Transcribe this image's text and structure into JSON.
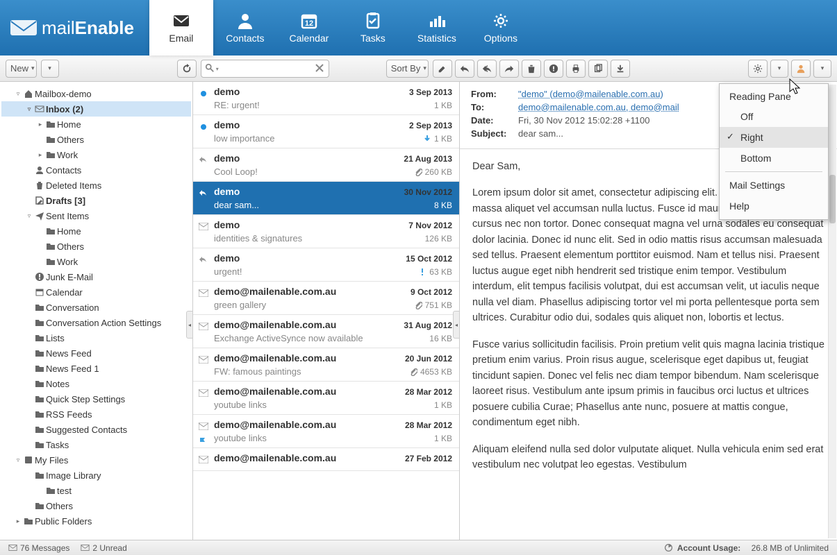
{
  "app": {
    "brand1": "mail",
    "brand2": "Enable"
  },
  "nav": [
    {
      "label": "Email",
      "active": true
    },
    {
      "label": "Contacts"
    },
    {
      "label": "Calendar",
      "badge": "12"
    },
    {
      "label": "Tasks"
    },
    {
      "label": "Statistics"
    },
    {
      "label": "Options"
    }
  ],
  "toolbar": {
    "new": "New",
    "sortby": "Sort By"
  },
  "tree": [
    {
      "indent": 1,
      "exp": "▿",
      "ico": "home",
      "label": "Mailbox-demo"
    },
    {
      "indent": 2,
      "exp": "▿",
      "ico": "mail",
      "label": "Inbox (2)",
      "selected": true,
      "bold": true
    },
    {
      "indent": 3,
      "exp": "▸",
      "ico": "folder",
      "label": "Home"
    },
    {
      "indent": 3,
      "exp": "",
      "ico": "folder",
      "label": "Others"
    },
    {
      "indent": 3,
      "exp": "▸",
      "ico": "folder",
      "label": "Work"
    },
    {
      "indent": 2,
      "exp": "",
      "ico": "contacts",
      "label": "Contacts"
    },
    {
      "indent": 2,
      "exp": "",
      "ico": "trash",
      "label": "Deleted Items"
    },
    {
      "indent": 2,
      "exp": "",
      "ico": "draft",
      "label": "Drafts [3]",
      "bold": true
    },
    {
      "indent": 2,
      "exp": "▿",
      "ico": "sent",
      "label": "Sent Items"
    },
    {
      "indent": 3,
      "exp": "",
      "ico": "folder",
      "label": "Home"
    },
    {
      "indent": 3,
      "exp": "",
      "ico": "folder",
      "label": "Others"
    },
    {
      "indent": 3,
      "exp": "",
      "ico": "folder",
      "label": "Work"
    },
    {
      "indent": 2,
      "exp": "",
      "ico": "junk",
      "label": "Junk E-Mail"
    },
    {
      "indent": 2,
      "exp": "",
      "ico": "cal",
      "label": "Calendar"
    },
    {
      "indent": 2,
      "exp": "",
      "ico": "folder",
      "label": "Conversation"
    },
    {
      "indent": 2,
      "exp": "",
      "ico": "folder",
      "label": "Conversation Action Settings"
    },
    {
      "indent": 2,
      "exp": "",
      "ico": "folder",
      "label": "Lists"
    },
    {
      "indent": 2,
      "exp": "",
      "ico": "folder",
      "label": "News Feed"
    },
    {
      "indent": 2,
      "exp": "",
      "ico": "folder",
      "label": "News Feed 1"
    },
    {
      "indent": 2,
      "exp": "",
      "ico": "folder",
      "label": "Notes"
    },
    {
      "indent": 2,
      "exp": "",
      "ico": "folder",
      "label": "Quick Step Settings"
    },
    {
      "indent": 2,
      "exp": "",
      "ico": "folder",
      "label": "RSS Feeds"
    },
    {
      "indent": 2,
      "exp": "",
      "ico": "folder",
      "label": "Suggested Contacts"
    },
    {
      "indent": 2,
      "exp": "",
      "ico": "folder",
      "label": "Tasks"
    },
    {
      "indent": 1,
      "exp": "▿",
      "ico": "disk",
      "label": "My Files"
    },
    {
      "indent": 2,
      "exp": "",
      "ico": "folder",
      "label": "Image Library"
    },
    {
      "indent": 3,
      "exp": "",
      "ico": "folder",
      "label": "test"
    },
    {
      "indent": 2,
      "exp": "",
      "ico": "folder",
      "label": "Others"
    },
    {
      "indent": 1,
      "exp": "▸",
      "ico": "pfolder",
      "label": "Public Folders"
    }
  ],
  "messages": [
    {
      "status": "unread",
      "from": "demo",
      "date": "3 Sep 2013",
      "subject": "RE: urgent!",
      "size": "1 KB"
    },
    {
      "status": "unread",
      "from": "demo",
      "date": "2 Sep 2013",
      "subject": "low importance",
      "size": "1 KB",
      "sizeico": "down"
    },
    {
      "status": "reply",
      "from": "demo",
      "date": "21 Aug 2013",
      "subject": "Cool Loop!",
      "size": "260 KB",
      "sizeico": "clip"
    },
    {
      "status": "reply",
      "from": "demo",
      "date": "30 Nov 2012",
      "subject": "dear sam...",
      "size": "8 KB",
      "selected": true
    },
    {
      "status": "read",
      "from": "demo",
      "date": "7 Nov 2012",
      "subject": "identities & signatures",
      "size": "126 KB"
    },
    {
      "status": "reply",
      "from": "demo",
      "date": "15 Oct 2012",
      "subject": "urgent!",
      "size": "63 KB",
      "sizeico": "bang"
    },
    {
      "status": "read",
      "from": "demo@mailenable.com.au",
      "date": "9 Oct 2012",
      "subject": "green gallery",
      "size": "751 KB",
      "sizeico": "clip"
    },
    {
      "status": "read",
      "from": "demo@mailenable.com.au",
      "date": "31 Aug 2012",
      "subject": "Exchange ActiveSynce now available",
      "size": "16 KB"
    },
    {
      "status": "read",
      "from": "demo@mailenable.com.au",
      "date": "20 Jun 2012",
      "subject": "FW: famous paintings",
      "size": "4653 KB",
      "sizeico": "clip"
    },
    {
      "status": "read",
      "from": "demo@mailenable.com.au",
      "date": "28 Mar 2012",
      "subject": "youtube links",
      "size": "1 KB"
    },
    {
      "status": "read",
      "from": "demo@mailenable.com.au",
      "date": "28 Mar 2012",
      "subject": "youtube links",
      "size": "1 KB",
      "flag": true
    },
    {
      "status": "read",
      "from": "demo@mailenable.com.au",
      "date": "27 Feb 2012",
      "subject": "",
      "size": ""
    }
  ],
  "pane": {
    "from_label": "From:",
    "from": "\"demo\" (demo@mailenable.com.au)",
    "to_label": "To:",
    "to": "demo@mailenable.com.au, demo@mail",
    "date_label": "Date:",
    "date": "Fri, 30 Nov 2012 15:02:28 +1100",
    "subject_label": "Subject:",
    "subject": "dear sam...",
    "greeting": "Dear Sam,",
    "para1": "Lorem ipsum dolor sit amet, consectetur adipiscing elit. Nulla lacinia arcu vel massa aliquet vel accumsan nulla luctus. Fusce id mauris eget enim varius cursus nec non tortor. Donec consequat magna vel urna sodales eu consequat dolor lacinia. Donec id nunc elit. Sed in odio mattis risus accumsan malesuada sed tellus. Praesent elementum porttitor euismod. Nam et tellus nisi. Praesent luctus augue eget nibh hendrerit sed tristique enim tempor. Vestibulum interdum, elit tempus facilisis volutpat, dui est accumsan velit, ut iaculis neque nulla vel diam. Phasellus adipiscing tortor vel mi porta pellentesque porta sem ultrices. Curabitur odio dui, sodales quis aliquet non, lobortis et lectus.",
    "para2": "Fusce varius sollicitudin facilisis. Proin pretium velit quis magna lacinia tristique pretium enim varius. Proin risus augue, scelerisque eget dapibus ut, feugiat tincidunt sapien. Donec vel felis nec diam tempor bibendum. Nam scelerisque laoreet risus. Vestibulum ante ipsum primis in faucibus orci luctus et ultrices posuere cubilia Curae; Phasellus ante nunc, posuere at mattis congue, condimentum eget nibh.",
    "para3": "Aliquam eleifend nulla sed dolor vulputate aliquet. Nulla vehicula enim sed erat vestibulum nec volutpat leo egestas. Vestibulum"
  },
  "menu": {
    "title": "Reading Pane",
    "off": "Off",
    "right": "Right",
    "bottom": "Bottom",
    "settings": "Mail Settings",
    "help": "Help"
  },
  "status": {
    "messages": "76 Messages",
    "unread": "2 Unread",
    "usage_label": "Account Usage:",
    "usage": "26.8 MB of Unlimited"
  }
}
